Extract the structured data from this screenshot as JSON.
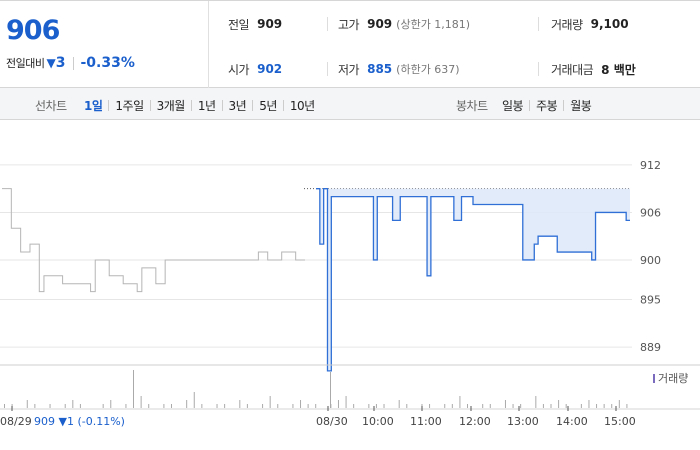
{
  "summary": {
    "price": "906",
    "change_label": "전일대비",
    "change_arrow": "▼",
    "change_abs": "3",
    "change_pct": "-0.33%"
  },
  "stats": {
    "prev_close_label": "전일",
    "prev_close": "909",
    "open_label": "시가",
    "open": "902",
    "high_label": "고가",
    "high": "909",
    "upper_limit": "(상한가 1,181)",
    "low_label": "저가",
    "low": "885",
    "lower_limit": "(하한가 637)",
    "volume_label": "거래량",
    "volume": "9,100",
    "value_label": "거래대금",
    "value": "8 백만"
  },
  "toolbar": {
    "line_chart_label": "선차트",
    "line_tabs": [
      "1일",
      "1주일",
      "3개월",
      "1년",
      "3년",
      "5년",
      "10년"
    ],
    "active_line_tab": "1일",
    "candle_label": "봉차트",
    "candle_tabs": [
      "일봉",
      "주봉",
      "월봉"
    ]
  },
  "colors": {
    "down": "#1a5fcc",
    "today_line": "#2f6fd6",
    "today_fill": "#dce8f8",
    "prev_line": "#b5b5b5"
  },
  "volume_legend": "거래량",
  "bottom": {
    "prev_date": "08/29",
    "prev_info": "909 ▼1 (-0.11%)"
  },
  "chart_data": {
    "type": "line",
    "ylim": [
      888,
      913
    ],
    "yticks": [
      912,
      906,
      900,
      895,
      889
    ],
    "reference_price": 909,
    "x_labels": [
      "08/29",
      "08/30",
      "10:00",
      "11:00",
      "12:00",
      "13:00",
      "14:00",
      "15:00"
    ],
    "prev_day_series": [
      909,
      909,
      904,
      904,
      901,
      901,
      902,
      902,
      896,
      898,
      898,
      898,
      898,
      897,
      897,
      897,
      897,
      897,
      897,
      896,
      900,
      900,
      900,
      898,
      898,
      898,
      897,
      897,
      897,
      896,
      899,
      899,
      899,
      897,
      897,
      900,
      900,
      900,
      900,
      900,
      900,
      900,
      900,
      900,
      900,
      900,
      900,
      900,
      900,
      900,
      900,
      900,
      900,
      900,
      900,
      901,
      901,
      900,
      900,
      900,
      901,
      901,
      901,
      900,
      900,
      900
    ],
    "today_series": [
      909,
      902,
      909,
      886,
      908,
      908,
      908,
      908,
      908,
      908,
      908,
      908,
      908,
      908,
      908,
      900,
      908,
      908,
      908,
      908,
      905,
      905,
      908,
      908,
      908,
      908,
      908,
      908,
      908,
      898,
      908,
      908,
      908,
      908,
      908,
      908,
      905,
      905,
      908,
      908,
      908,
      907,
      907,
      907,
      907,
      907,
      907,
      907,
      907,
      907,
      907,
      907,
      907,
      907,
      900,
      900,
      900,
      902,
      903,
      903,
      903,
      903,
      903,
      901,
      901,
      901,
      901,
      901,
      901,
      901,
      901,
      901,
      900,
      906,
      906,
      906,
      906,
      906,
      906,
      906,
      906,
      905,
      905
    ],
    "volume_series": [
      1,
      1,
      0,
      2,
      1,
      0,
      1,
      0,
      1,
      2,
      1,
      0,
      0,
      1,
      2,
      0,
      1,
      0,
      3,
      1,
      0,
      1,
      1,
      0,
      2,
      4,
      1,
      0,
      1,
      1,
      0,
      2,
      1,
      0,
      1,
      3,
      1,
      0,
      1,
      2,
      1,
      1,
      0,
      1,
      2,
      3,
      1,
      0,
      1,
      1,
      1,
      0,
      2,
      1,
      0,
      1,
      1,
      0,
      1,
      1,
      3,
      1,
      0,
      1,
      1,
      0,
      2,
      1,
      1,
      0,
      3,
      1,
      1,
      2,
      1,
      0,
      1,
      2,
      1,
      1,
      1,
      2,
      1
    ]
  }
}
